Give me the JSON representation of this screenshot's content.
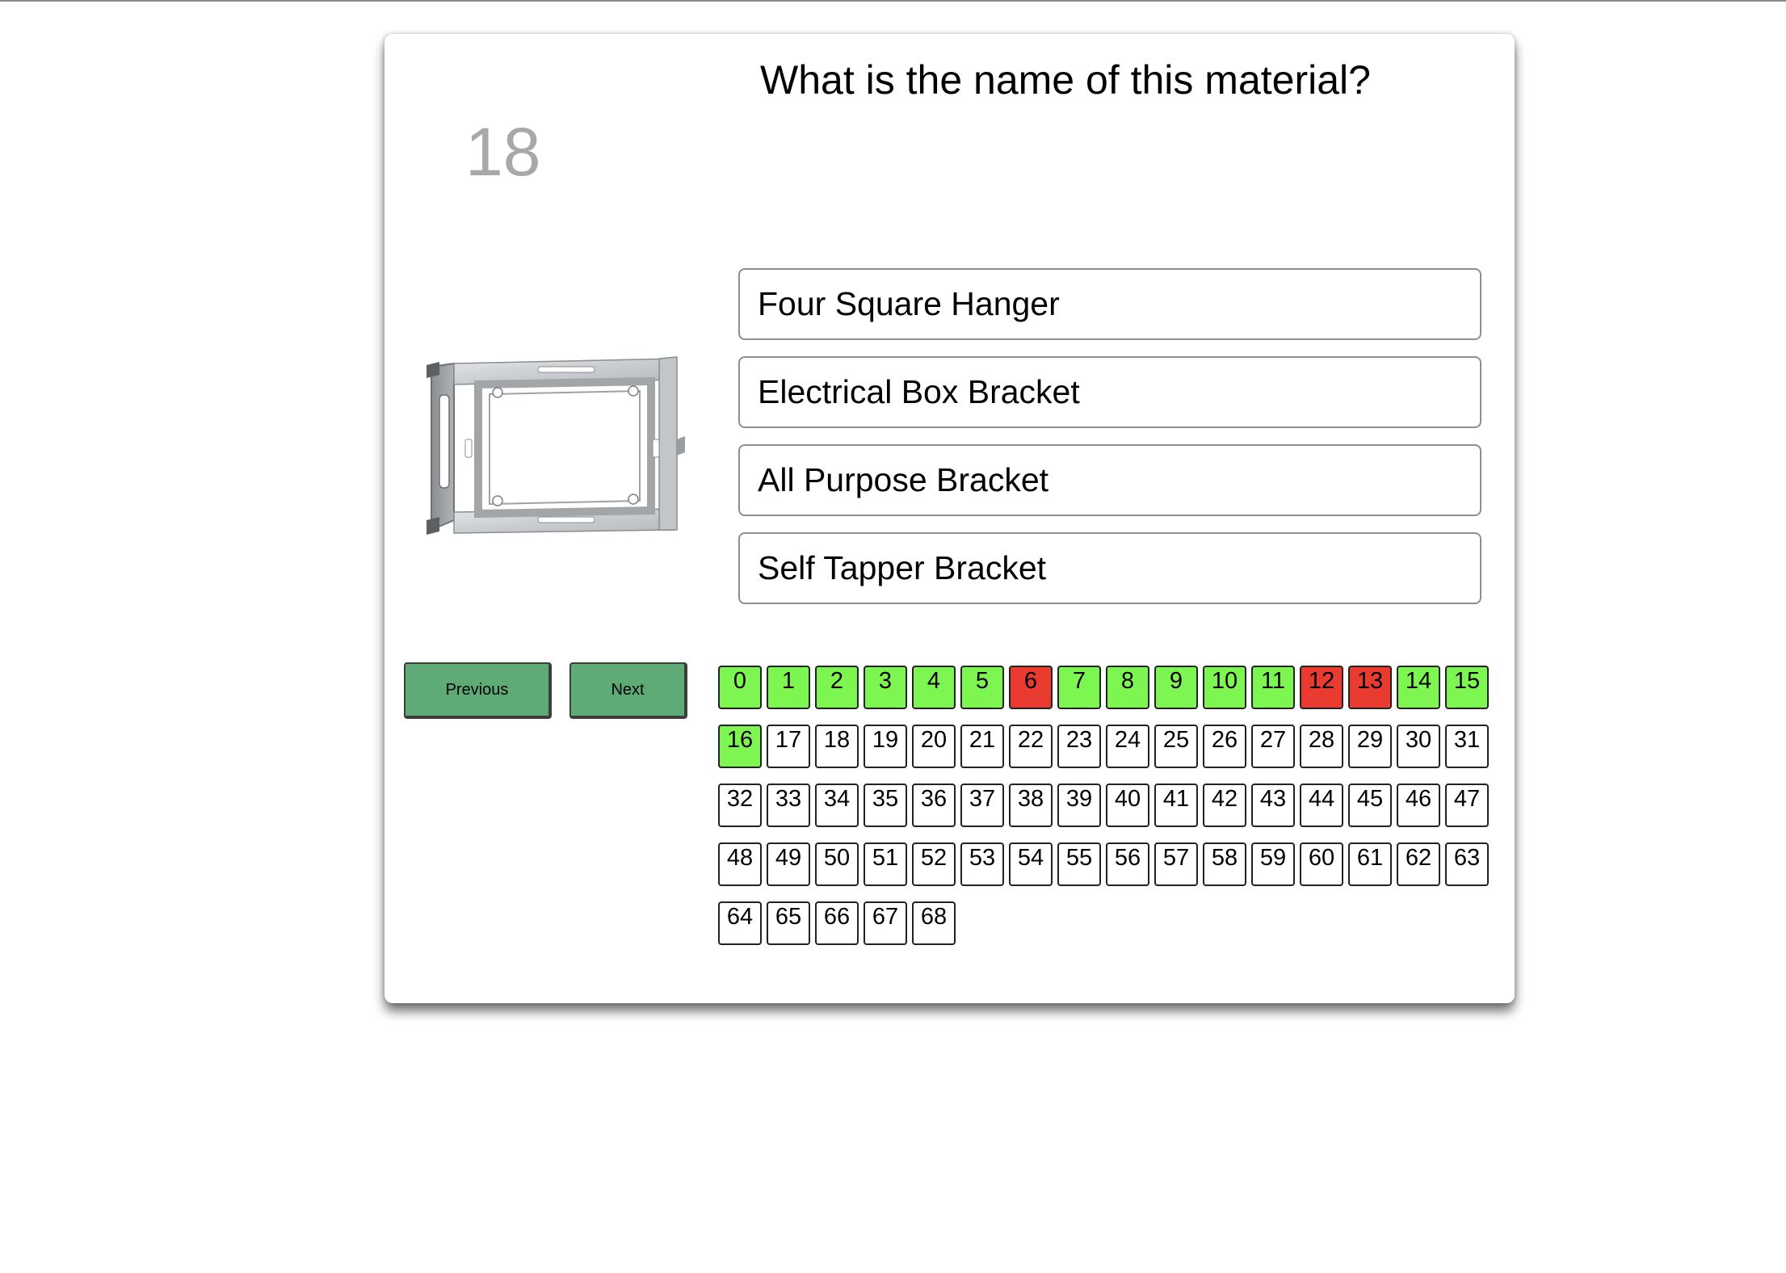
{
  "quiz": {
    "question": "What is the name of this material?",
    "counter": "18",
    "image_alt": "metal electrical box bracket",
    "answers": [
      "Four Square Hanger",
      "Electrical Box Bracket",
      "All Purpose Bracket",
      "Self Tapper Bracket"
    ],
    "nav": {
      "previous_label": "Previous",
      "next_label": "Next"
    },
    "grid": {
      "colors": {
        "correct": "#7df651",
        "wrong": "#e93b2f",
        "unanswered": "#ffffff"
      },
      "cells": [
        {
          "label": "0",
          "status": "correct"
        },
        {
          "label": "1",
          "status": "correct"
        },
        {
          "label": "2",
          "status": "correct"
        },
        {
          "label": "3",
          "status": "correct"
        },
        {
          "label": "4",
          "status": "correct"
        },
        {
          "label": "5",
          "status": "correct"
        },
        {
          "label": "6",
          "status": "wrong"
        },
        {
          "label": "7",
          "status": "correct"
        },
        {
          "label": "8",
          "status": "correct"
        },
        {
          "label": "9",
          "status": "correct"
        },
        {
          "label": "10",
          "status": "correct"
        },
        {
          "label": "11",
          "status": "correct"
        },
        {
          "label": "12",
          "status": "wrong"
        },
        {
          "label": "13",
          "status": "wrong"
        },
        {
          "label": "14",
          "status": "correct"
        },
        {
          "label": "15",
          "status": "correct"
        },
        {
          "label": "16",
          "status": "correct"
        },
        {
          "label": "17",
          "status": "unanswered"
        },
        {
          "label": "18",
          "status": "unanswered"
        },
        {
          "label": "19",
          "status": "unanswered"
        },
        {
          "label": "20",
          "status": "unanswered"
        },
        {
          "label": "21",
          "status": "unanswered"
        },
        {
          "label": "22",
          "status": "unanswered"
        },
        {
          "label": "23",
          "status": "unanswered"
        },
        {
          "label": "24",
          "status": "unanswered"
        },
        {
          "label": "25",
          "status": "unanswered"
        },
        {
          "label": "26",
          "status": "unanswered"
        },
        {
          "label": "27",
          "status": "unanswered"
        },
        {
          "label": "28",
          "status": "unanswered"
        },
        {
          "label": "29",
          "status": "unanswered"
        },
        {
          "label": "30",
          "status": "unanswered"
        },
        {
          "label": "31",
          "status": "unanswered"
        },
        {
          "label": "32",
          "status": "unanswered"
        },
        {
          "label": "33",
          "status": "unanswered"
        },
        {
          "label": "34",
          "status": "unanswered"
        },
        {
          "label": "35",
          "status": "unanswered"
        },
        {
          "label": "36",
          "status": "unanswered"
        },
        {
          "label": "37",
          "status": "unanswered"
        },
        {
          "label": "38",
          "status": "unanswered"
        },
        {
          "label": "39",
          "status": "unanswered"
        },
        {
          "label": "40",
          "status": "unanswered"
        },
        {
          "label": "41",
          "status": "unanswered"
        },
        {
          "label": "42",
          "status": "unanswered"
        },
        {
          "label": "43",
          "status": "unanswered"
        },
        {
          "label": "44",
          "status": "unanswered"
        },
        {
          "label": "45",
          "status": "unanswered"
        },
        {
          "label": "46",
          "status": "unanswered"
        },
        {
          "label": "47",
          "status": "unanswered"
        },
        {
          "label": "48",
          "status": "unanswered"
        },
        {
          "label": "49",
          "status": "unanswered"
        },
        {
          "label": "50",
          "status": "unanswered"
        },
        {
          "label": "51",
          "status": "unanswered"
        },
        {
          "label": "52",
          "status": "unanswered"
        },
        {
          "label": "53",
          "status": "unanswered"
        },
        {
          "label": "54",
          "status": "unanswered"
        },
        {
          "label": "55",
          "status": "unanswered"
        },
        {
          "label": "56",
          "status": "unanswered"
        },
        {
          "label": "57",
          "status": "unanswered"
        },
        {
          "label": "58",
          "status": "unanswered"
        },
        {
          "label": "59",
          "status": "unanswered"
        },
        {
          "label": "60",
          "status": "unanswered"
        },
        {
          "label": "61",
          "status": "unanswered"
        },
        {
          "label": "62",
          "status": "unanswered"
        },
        {
          "label": "63",
          "status": "unanswered"
        },
        {
          "label": "64",
          "status": "unanswered"
        },
        {
          "label": "65",
          "status": "unanswered"
        },
        {
          "label": "66",
          "status": "unanswered"
        },
        {
          "label": "67",
          "status": "unanswered"
        },
        {
          "label": "68",
          "status": "unanswered"
        }
      ]
    }
  }
}
